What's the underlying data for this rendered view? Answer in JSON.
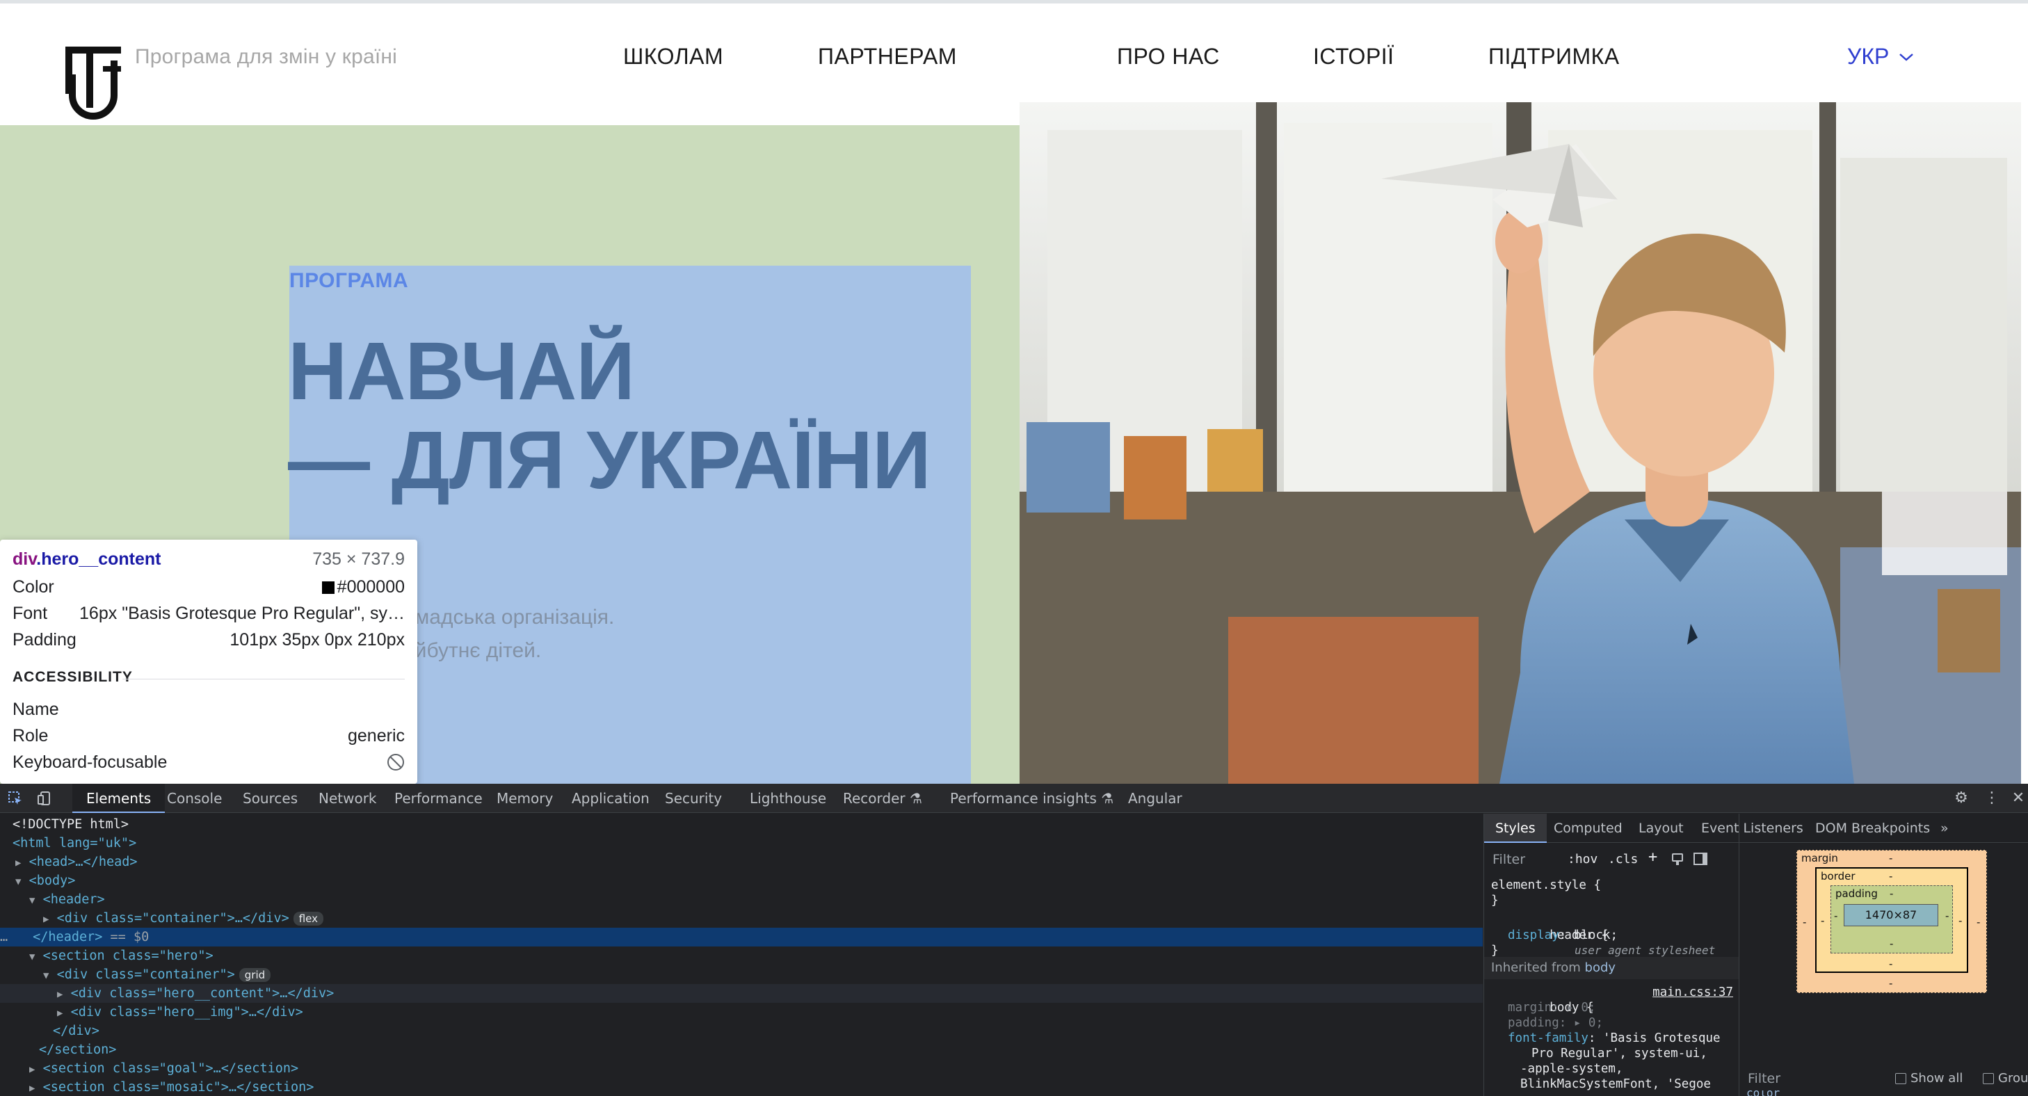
{
  "header": {
    "tagline": "Програма для змін у країні",
    "nav": [
      "ШКОЛАМ",
      "ПАРТНЕРАМ",
      "ПРО НАС",
      "ІСТОРІЇ",
      "ПІДТРИМКА"
    ],
    "language": "УКР"
  },
  "hero": {
    "eyebrow": "ПРОГРАМА",
    "title_line1": "НАВЧАЙ",
    "title_line2": "— ДЛЯ УКРАЇНИ",
    "desc_line1": "омадська організація.",
    "desc_line2": "айбутнє дітей."
  },
  "inspector_tooltip": {
    "tag": "div",
    "class": ".hero__content",
    "dimensions": "735 × 737.9",
    "color_label": "Color",
    "color_value": "#000000",
    "font_label": "Font",
    "font_value": "16px \"Basis Grotesque Pro Regular\", sy…",
    "padding_label": "Padding",
    "padding_value": "101px 35px 0px 210px",
    "accessibility_heading": "ACCESSIBILITY",
    "name_label": "Name",
    "role_label": "Role",
    "role_value": "generic",
    "focusable_label": "Keyboard-focusable"
  },
  "devtools": {
    "tabs": [
      "Elements",
      "Console",
      "Sources",
      "Network",
      "Performance",
      "Memory",
      "Application",
      "Security",
      "Lighthouse",
      "Recorder ⚗",
      "Performance insights ⚗",
      "Angular"
    ],
    "dom": {
      "doctype": "<!DOCTYPE html>",
      "html_open": "<html lang=\"uk\">",
      "head": "<head>…</head>",
      "body_open": "<body>",
      "header_open": "<header>",
      "container_div": "<div class=\"container\">…</div>",
      "flex_badge": "flex",
      "header_close": "</header>",
      "selected_marker": "== $0",
      "section_hero": "<section class=\"hero\">",
      "container_open": "<div class=\"container\">",
      "grid_badge": "grid",
      "hero_content": "<div class=\"hero__content\">…</div>",
      "hero_img": "<div class=\"hero__img\">…</div>",
      "div_close": "</div>",
      "section_close": "</section>",
      "section_goal": "<section class=\"goal\">…</section>",
      "section_mosaic": "<section class=\"mosaic\">…</section>"
    },
    "styles_tabs": [
      "Styles",
      "Computed",
      "Layout",
      "Event Listeners",
      "DOM Breakpoints"
    ],
    "filter_placeholder": "Filter",
    "hov": ":hov",
    "cls": ".cls",
    "rules": {
      "element_style": "element.style {",
      "close_brace": "}",
      "header_sel": "header {",
      "ua_label": "user agent stylesheet",
      "display_prop": "display",
      "display_val": "block;",
      "inherited_label": "Inherited from",
      "inherited_el": "body",
      "body_sel": "body {",
      "body_link": "main.css:37",
      "margin_prop": "margin",
      "margin_val": "0;",
      "padding_prop": "padding",
      "padding_val": "0;",
      "font_prop": "font-family",
      "font_val_1": "'Basis Grotesque",
      "font_val_2": "Pro Regular', system-ui,",
      "font_val_3": "-apple-system,",
      "font_val_4": "BlinkMacSystemFont, 'Segoe"
    },
    "box_model": {
      "margin_label": "margin",
      "border_label": "border",
      "padding_label": "padding",
      "content_size": "1470×87",
      "dash": "-"
    },
    "computed_filter": "Filter",
    "show_all": "Show all",
    "group": "Group",
    "color_peek": "color"
  }
}
